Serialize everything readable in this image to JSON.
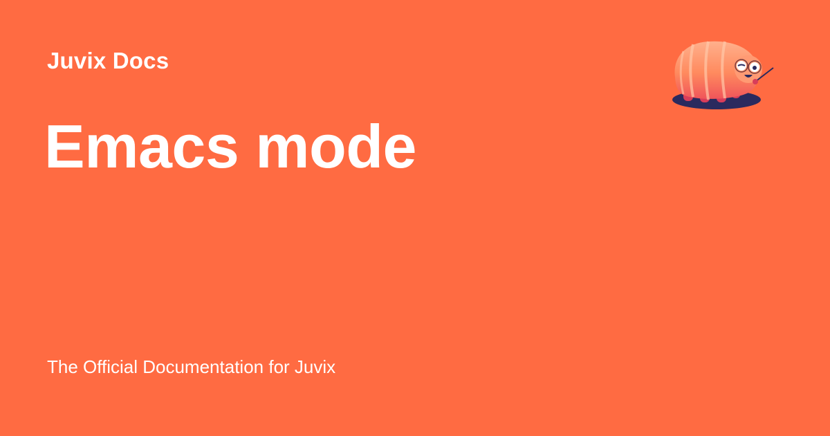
{
  "colors": {
    "background": "#ff6b42",
    "text": "#ffffff"
  },
  "header": {
    "site_name": "Juvix Docs",
    "logo_icon": "juvix-tardigrade-mascot-icon"
  },
  "main": {
    "title": "Emacs mode",
    "description": "The Official Documentation for Juvix"
  }
}
